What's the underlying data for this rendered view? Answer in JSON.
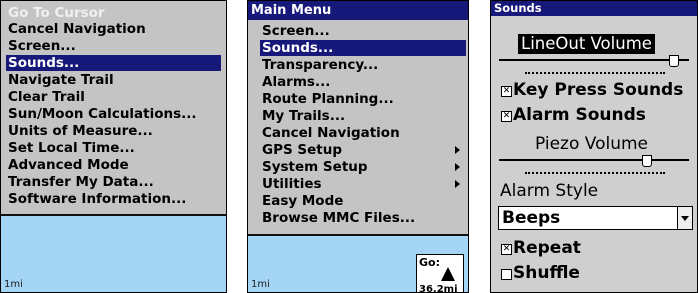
{
  "screen1": {
    "items": [
      "Go To Cursor",
      "Cancel Navigation",
      "Screen...",
      "Sounds...",
      "Navigate Trail",
      "Clear Trail",
      "Sun/Moon Calculations...",
      "Units of Measure...",
      "Set Local Time...",
      "Advanced Mode",
      "Transfer My Data...",
      "Software Information..."
    ],
    "scale": "1mi"
  },
  "screen2": {
    "title": "Main Menu",
    "items": [
      "Screen...",
      "Sounds...",
      "Transparency...",
      "Alarms...",
      "Route Planning...",
      "My Trails...",
      "Cancel Navigation",
      "GPS Setup",
      "System Setup",
      "Utilities",
      "Easy Mode",
      "Browse MMC Files..."
    ],
    "scale": "1mi",
    "go_label": "Go:",
    "go_distance": "36.2mi"
  },
  "screen3": {
    "title": "Sounds",
    "lineout_label": "LineOut Volume",
    "lineout_level": 0.92,
    "key_press_label": "Key Press Sounds",
    "key_press_checked": true,
    "alarm_sounds_label": "Alarm Sounds",
    "alarm_sounds_checked": true,
    "piezo_label": "Piezo Volume",
    "piezo_level": 0.78,
    "alarm_style_label": "Alarm Style",
    "alarm_style_value": "Beeps",
    "repeat_label": "Repeat",
    "repeat_checked": true,
    "shuffle_label": "Shuffle",
    "shuffle_checked": false
  }
}
